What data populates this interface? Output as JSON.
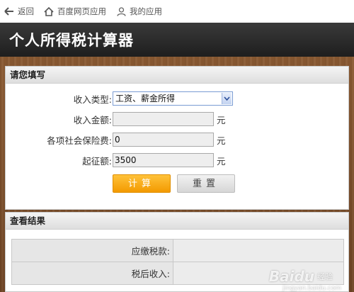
{
  "topnav": {
    "back_label": "返回",
    "baidu_apps_label": "百度网页应用",
    "my_apps_label": "我的应用"
  },
  "header": {
    "title": "个人所得税计算器"
  },
  "form": {
    "section_title": "请您填写",
    "income_type_label": "收入类型:",
    "income_type_value": "工资、薪金所得",
    "income_amount_label": "收入金额:",
    "income_amount_value": "",
    "insurance_label": "各项社会保险费:",
    "insurance_value": "0",
    "threshold_label": "起征额:",
    "threshold_value": "3500",
    "unit": "元",
    "calc_button": "计算",
    "reset_button": "重置"
  },
  "results": {
    "section_title": "查看结果",
    "tax_payable_label": "应缴税款:",
    "tax_payable_value": "",
    "after_tax_label": "税后收入:",
    "after_tax_value": ""
  },
  "watermark": {
    "brand": "Baidu",
    "sub": "经验",
    "url": "jingyan.baidu.com"
  },
  "colors": {
    "title_bar": "#2b2b2b",
    "calc_button": "#f5a300",
    "select_border": "#7a9cd3"
  }
}
